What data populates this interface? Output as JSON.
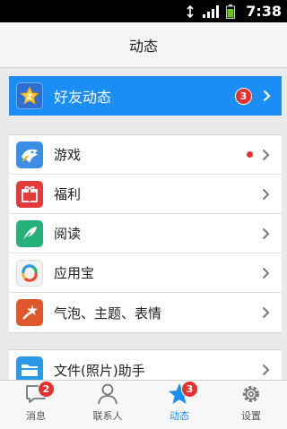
{
  "status_bar": {
    "time": "7:38",
    "icons": [
      "sync-icon",
      "signal-icon",
      "battery-icon"
    ]
  },
  "header": {
    "title": "动态"
  },
  "friends_activity": {
    "label": "好友动态",
    "badge": "3",
    "accent_color": "#1a8ef5"
  },
  "list_items": [
    {
      "label": "游戏",
      "icon": "game-icon",
      "has_dot": true
    },
    {
      "label": "福利",
      "icon": "gift-icon"
    },
    {
      "label": "阅读",
      "icon": "reading-icon"
    },
    {
      "label": "应用宝",
      "icon": "app-store-icon"
    },
    {
      "label": "气泡、主题、表情",
      "icon": "theme-icon"
    }
  ],
  "list_items_2": [
    {
      "label": "文件(照片)助手",
      "icon": "file-folder-icon"
    }
  ],
  "tabs": [
    {
      "label": "消息",
      "icon": "chat-bubble-icon",
      "badge": "2"
    },
    {
      "label": "联系人",
      "icon": "person-icon"
    },
    {
      "label": "动态",
      "icon": "star-icon",
      "badge": "3",
      "active": true
    },
    {
      "label": "设置",
      "icon": "gear-icon"
    }
  ]
}
